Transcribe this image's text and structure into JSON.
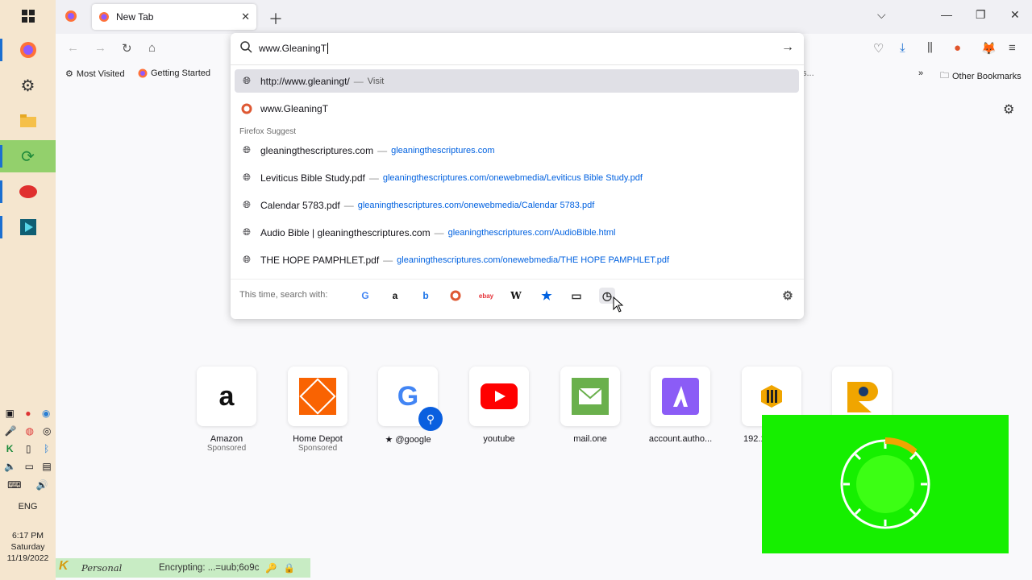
{
  "browser": {
    "tab_title": "New Tab",
    "url_text": "www.GleaningT"
  },
  "bookmarks": {
    "most_visited": "Most Visited",
    "getting_started": "Getting Started",
    "overflow_truncated": "s...",
    "other": "Other Bookmarks"
  },
  "dropdown": {
    "visit_row": {
      "url": "http://www.gleaningt/",
      "action": "Visit"
    },
    "search_row": {
      "text": "www.GleaningT"
    },
    "section_title": "Firefox Suggest",
    "suggestions": [
      {
        "title": "gleaningthescriptures.com",
        "url": "gleaningthescriptures.com"
      },
      {
        "title": "Leviticus Bible Study.pdf",
        "url": "gleaningthescriptures.com/onewebmedia/Leviticus Bible Study.pdf"
      },
      {
        "title": "Calendar 5783.pdf",
        "url": "gleaningthescriptures.com/onewebmedia/Calendar 5783.pdf"
      },
      {
        "title": "Audio Bible | gleaningthescriptures.com",
        "url": "gleaningthescriptures.com/AudioBible.html"
      },
      {
        "title": "THE HOPE PAMPHLET.pdf",
        "url": "gleaningthescriptures.com/onewebmedia/THE HOPE PAMPHLET.pdf"
      }
    ],
    "separator": "—",
    "search_with_label": "This time, search with:",
    "engines": [
      "google-icon",
      "amazon-icon",
      "bing-icon",
      "duckduckgo-icon",
      "ebay-icon",
      "wikipedia-icon",
      "bookmarks-star-icon",
      "tabs-icon",
      "history-icon"
    ]
  },
  "top_sites": [
    {
      "name": "Amazon",
      "sponsored": "Sponsored"
    },
    {
      "name": "Home Depot",
      "sponsored": "Sponsored"
    },
    {
      "name": "@google",
      "sponsored": ""
    },
    {
      "name": "youtube",
      "sponsored": ""
    },
    {
      "name": "mail.one",
      "sponsored": ""
    },
    {
      "name": "account.autho...",
      "sponsored": ""
    },
    {
      "name": "192.1",
      "sponsored": ""
    }
  ],
  "taskbar": {
    "language": "ENG",
    "time": "6:17 PM",
    "day": "Saturday",
    "date": "11/19/2022"
  },
  "statusbar": {
    "profile": "Personal",
    "encrypting": "Encrypting: ...=uub;6o9c"
  },
  "colors": {
    "accent": "#0061e0",
    "overlay_green": "#16ef00"
  }
}
